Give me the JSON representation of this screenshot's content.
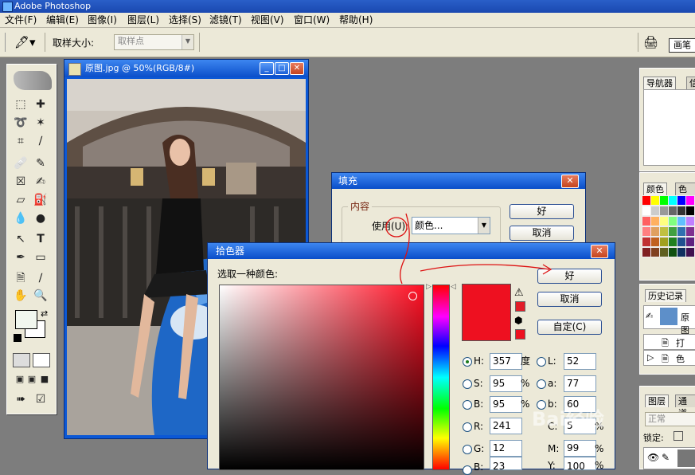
{
  "app": {
    "title": "Adobe Photoshop"
  },
  "menu": [
    "文件(F)",
    "编辑(E)",
    "图像(I)",
    "图层(L)",
    "选择(S)",
    "滤镜(T)",
    "视图(V)",
    "窗口(W)",
    "帮助(H)"
  ],
  "options": {
    "sample_label": "取样大小:",
    "sample_value": "取样点",
    "brush_tab": "画笔"
  },
  "document": {
    "title": "原图.jpg @ 50%(RGB/8#)"
  },
  "panels": {
    "navigator": {
      "tab1": "导航器",
      "tab2": "信"
    },
    "color": {
      "tab1": "颜色",
      "tab2": "色板"
    },
    "history": {
      "tab": "历史记录",
      "snapshot": "原图",
      "step1": "打",
      "step2": "色"
    },
    "layers": {
      "tab1": "图层",
      "tab2": "通道",
      "mode": "正常",
      "lock": "锁定:"
    }
  },
  "fill_dialog": {
    "title": "填充",
    "group": "内容",
    "use_label": "使用(U):",
    "use_value": "颜色...",
    "ok": "好",
    "cancel": "取消"
  },
  "color_picker": {
    "title": "拾色器",
    "prompt": "选取一种颜色:",
    "ok": "好",
    "cancel": "取消",
    "custom": "自定(C)",
    "color_hex": "#ee1020",
    "fields": {
      "H": {
        "label": "H:",
        "value": "357",
        "unit": "度"
      },
      "S": {
        "label": "S:",
        "value": "95",
        "unit": "%"
      },
      "B": {
        "label": "B:",
        "value": "95",
        "unit": "%"
      },
      "R": {
        "label": "R:",
        "value": "241",
        "unit": ""
      },
      "G": {
        "label": "G:",
        "value": "12",
        "unit": ""
      },
      "Bl": {
        "label": "B:",
        "value": "23",
        "unit": ""
      },
      "L": {
        "label": "L:",
        "value": "52",
        "unit": ""
      },
      "a": {
        "label": "a:",
        "value": "77",
        "unit": ""
      },
      "b": {
        "label": "b:",
        "value": "60",
        "unit": ""
      },
      "C": {
        "label": "C:",
        "value": "5",
        "unit": "%"
      },
      "M": {
        "label": "M:",
        "value": "99",
        "unit": "%"
      },
      "Y": {
        "label": "Y:",
        "value": "100",
        "unit": "%"
      }
    }
  },
  "watermark": "Bai经验"
}
